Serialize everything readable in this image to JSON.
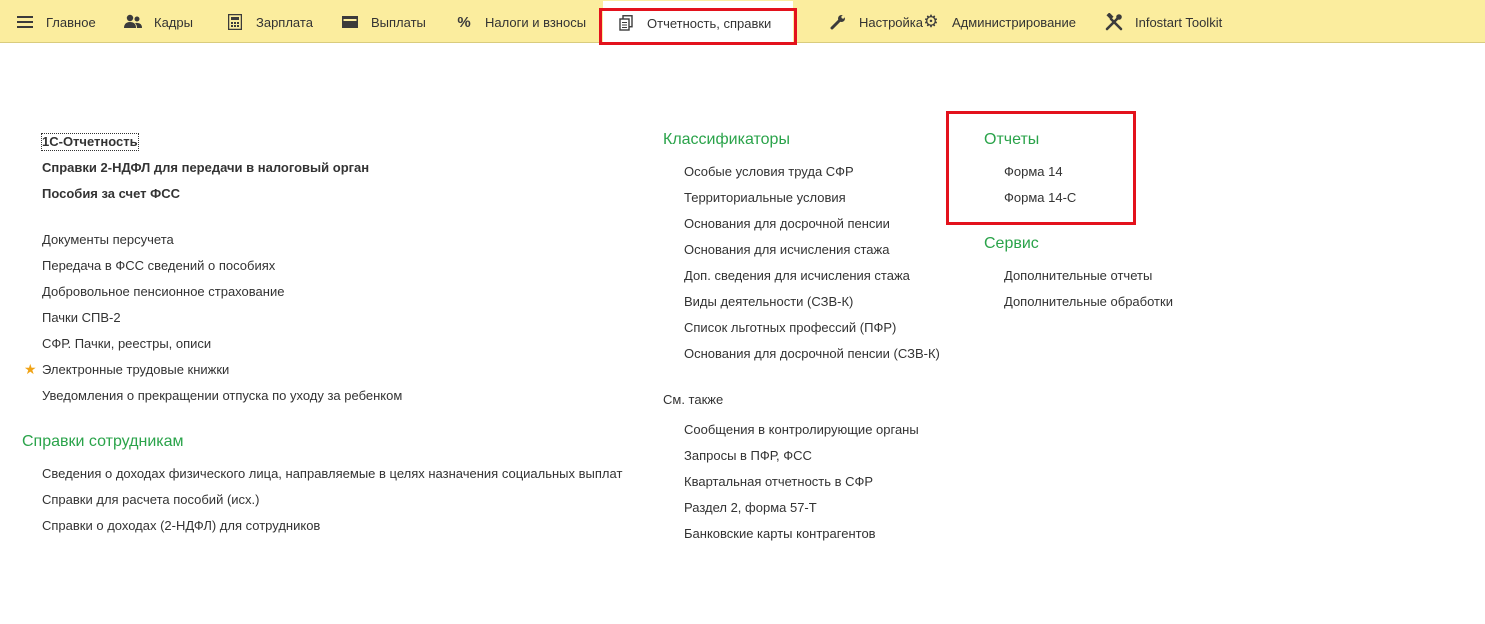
{
  "menu": {
    "items": [
      {
        "label": "Главное",
        "icon": "hamburger-icon"
      },
      {
        "label": "Кадры",
        "icon": "people-icon"
      },
      {
        "label": "Зарплата",
        "icon": "calculator-icon"
      },
      {
        "label": "Выплаты",
        "icon": "wallet-icon"
      },
      {
        "label": "Налоги и взносы",
        "icon": "percent-icon"
      },
      {
        "label": "Отчетность, справки",
        "icon": "documents-icon"
      },
      {
        "label": "Настройка",
        "icon": "wrench-icon"
      },
      {
        "label": "Администрирование",
        "icon": "gear-icon"
      },
      {
        "label": "Infostart Toolkit",
        "icon": "tools-icon"
      }
    ],
    "active_index": 5
  },
  "column1": {
    "main_links": [
      "1С-Отчетность",
      "Справки 2-НДФЛ для передачи в налоговый орган",
      "Пособия за счет ФСС"
    ],
    "links": [
      "Документы персучета",
      "Передача в ФСС сведений о пособиях",
      "Добровольное пенсионное страхование",
      "Пачки СПВ-2",
      "СФР. Пачки, реестры, описи",
      "Электронные трудовые книжки",
      "Уведомления о прекращении отпуска по уходу за ребенком"
    ],
    "employee_refs_title": "Справки сотрудникам",
    "employee_refs": [
      "Сведения о доходах физического лица, направляемые в целях назначения социальных выплат",
      "Справки для расчета пособий (исх.)",
      "Справки о доходах (2-НДФЛ) для сотрудников"
    ]
  },
  "column2": {
    "classifiers_title": "Классификаторы",
    "classifiers": [
      "Особые условия труда СФР",
      "Территориальные условия",
      "Основания для досрочной пенсии",
      "Основания для исчисления стажа",
      "Доп. сведения для исчисления стажа",
      "Виды деятельности (СЗВ-К)",
      "Список льготных профессий (ПФР)",
      "Основания для досрочной пенсии (СЗВ-К)"
    ],
    "see_also_title": "См. также",
    "see_also": [
      "Сообщения в контролирующие органы",
      "Запросы в ПФР, ФСС",
      "Квартальная отчетность в СФР",
      "Раздел 2, форма 57-Т",
      "Банковские карты контрагентов"
    ]
  },
  "column3": {
    "reports_title": "Отчеты",
    "reports": [
      "Форма 14",
      "Форма 14-С"
    ],
    "service_title": "Сервис",
    "service": [
      "Дополнительные отчеты",
      "Дополнительные обработки"
    ]
  },
  "colors": {
    "menubar": "#fbed9e",
    "group_title": "#2aa34a",
    "highlight": "#e3121c",
    "star": "#f0a316"
  }
}
